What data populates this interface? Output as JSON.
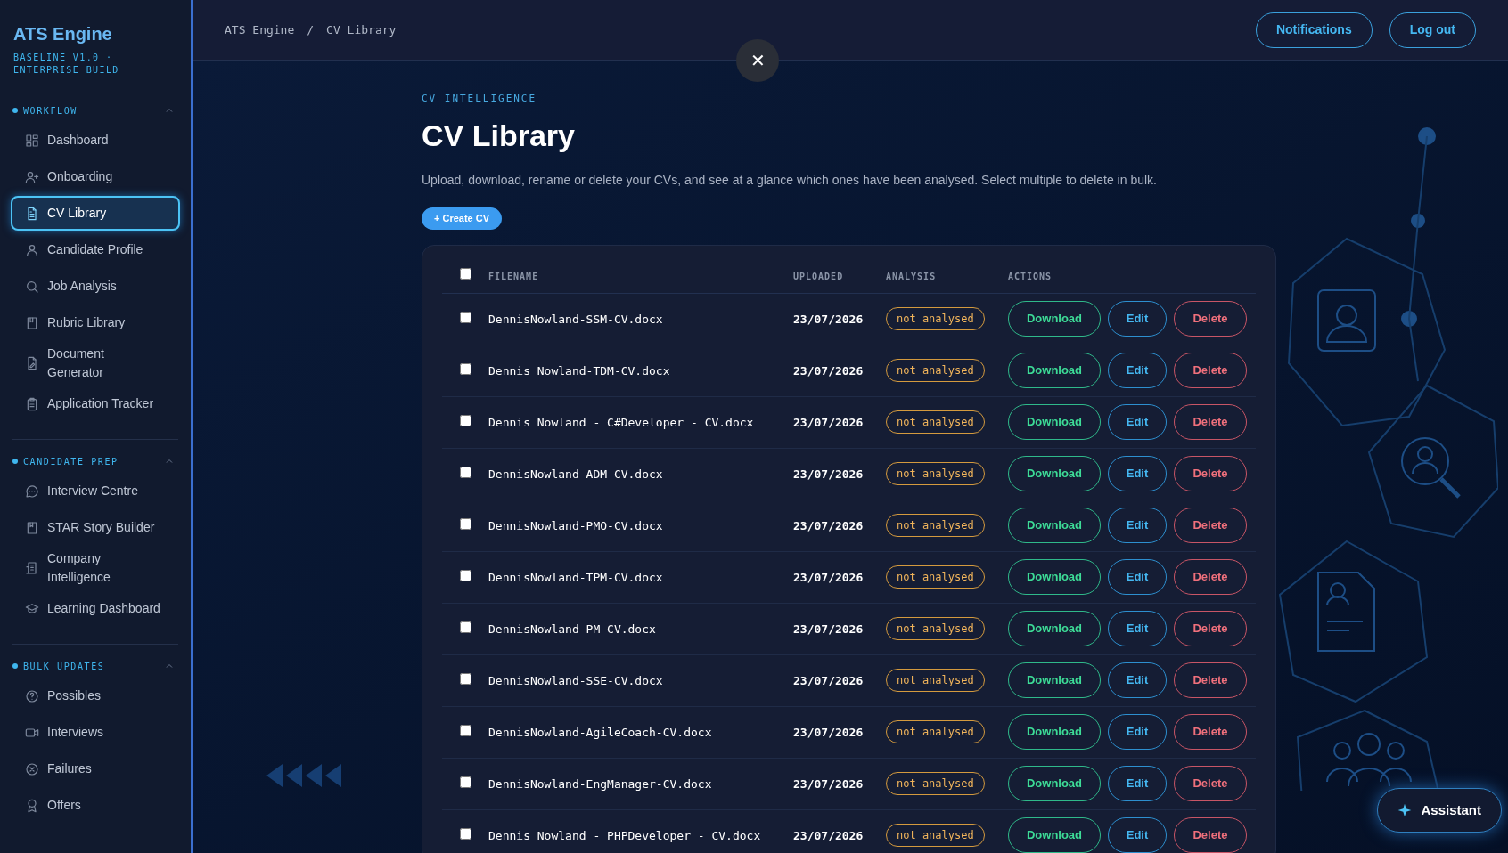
{
  "sidebar": {
    "logo": "ATS Engine",
    "subtitle": "BASELINE V1.0 · ENTERPRISE BUILD",
    "groups": [
      {
        "title": "WORKFLOW",
        "expanded": true,
        "items": [
          {
            "label": "Dashboard",
            "selected": false
          },
          {
            "label": "Onboarding",
            "selected": false
          },
          {
            "label": "CV Library",
            "selected": true
          },
          {
            "label": "Candidate Profile",
            "selected": false
          },
          {
            "label": "Job Analysis",
            "selected": false
          },
          {
            "label": "Rubric Library",
            "selected": false
          },
          {
            "label": "Document Generator",
            "selected": false
          },
          {
            "label": "Application Tracker",
            "selected": false
          }
        ]
      },
      {
        "title": "CANDIDATE PREP",
        "expanded": true,
        "items": [
          {
            "label": "Interview Centre",
            "selected": false
          },
          {
            "label": "STAR Story Builder",
            "selected": false
          },
          {
            "label": "Company Intelligence",
            "selected": false
          },
          {
            "label": "Learning Dashboard",
            "selected": false
          }
        ]
      },
      {
        "title": "BULK UPDATES",
        "expanded": true,
        "items": [
          {
            "label": "Possibles",
            "selected": false
          },
          {
            "label": "Interviews",
            "selected": false
          },
          {
            "label": "Failures",
            "selected": false
          },
          {
            "label": "Offers",
            "selected": false
          }
        ]
      }
    ]
  },
  "breadcrumb": [
    "ATS Engine",
    "/",
    "CV Library"
  ],
  "header_buttons": [
    "Notifications",
    "Log out"
  ],
  "close_button": "✕",
  "eyebrow": "CV INTELLIGENCE",
  "title": "CV Library",
  "description": "Upload, download, rename or delete your CVs, and see at a glance which ones have been analysed. Select multiple to delete in bulk.",
  "create_button": "+ Create CV",
  "table": {
    "select_all": {
      "checked": false
    },
    "columns": [
      "FILENAME",
      "UPLOADED",
      "ANALYSIS",
      "ACTIONS"
    ],
    "rows": [
      {
        "checked": false,
        "filename": "DennisNowland-SSM-CV.docx",
        "uploaded": "23/07/2026",
        "analysis": "not analysed",
        "actions": [
          "Download",
          "Edit",
          "Delete"
        ]
      },
      {
        "checked": false,
        "filename": "Dennis Nowland-TDM-CV.docx",
        "uploaded": "23/07/2026",
        "analysis": "not analysed",
        "actions": [
          "Download",
          "Edit",
          "Delete"
        ]
      },
      {
        "checked": false,
        "filename": "Dennis Nowland - C#Developer - CV.docx",
        "uploaded": "23/07/2026",
        "analysis": "not analysed",
        "actions": [
          "Download",
          "Edit",
          "Delete"
        ]
      },
      {
        "checked": false,
        "filename": "DennisNowland-ADM-CV.docx",
        "uploaded": "23/07/2026",
        "analysis": "not analysed",
        "actions": [
          "Download",
          "Edit",
          "Delete"
        ]
      },
      {
        "checked": false,
        "filename": "DennisNowland-PMO-CV.docx",
        "uploaded": "23/07/2026",
        "analysis": "not analysed",
        "actions": [
          "Download",
          "Edit",
          "Delete"
        ]
      },
      {
        "checked": false,
        "filename": "DennisNowland-TPM-CV.docx",
        "uploaded": "23/07/2026",
        "analysis": "not analysed",
        "actions": [
          "Download",
          "Edit",
          "Delete"
        ]
      },
      {
        "checked": false,
        "filename": "DennisNowland-PM-CV.docx",
        "uploaded": "23/07/2026",
        "analysis": "not analysed",
        "actions": [
          "Download",
          "Edit",
          "Delete"
        ]
      },
      {
        "checked": false,
        "filename": "DennisNowland-SSE-CV.docx",
        "uploaded": "23/07/2026",
        "analysis": "not analysed",
        "actions": [
          "Download",
          "Edit",
          "Delete"
        ]
      },
      {
        "checked": false,
        "filename": "DennisNowland-AgileCoach-CV.docx",
        "uploaded": "23/07/2026",
        "analysis": "not analysed",
        "actions": [
          "Download",
          "Edit",
          "Delete"
        ]
      },
      {
        "checked": false,
        "filename": "DennisNowland-EngManager-CV.docx",
        "uploaded": "23/07/2026",
        "analysis": "not analysed",
        "actions": [
          "Download",
          "Edit",
          "Delete"
        ]
      },
      {
        "checked": false,
        "filename": "Dennis Nowland - PHPDeveloper - CV.docx",
        "uploaded": "23/07/2026",
        "analysis": "not analysed",
        "actions": [
          "Download",
          "Edit",
          "Delete"
        ]
      }
    ]
  },
  "assistant_button": "Assistant"
}
